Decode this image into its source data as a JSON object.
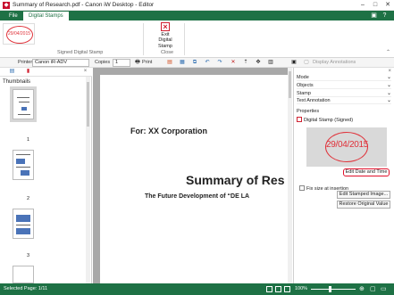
{
  "window": {
    "title": "Summary of Research.pdf - Canon iW Desktop - Editor",
    "app_icon": "canon-app-icon"
  },
  "ribbon": {
    "tabs": [
      {
        "label": "File"
      },
      {
        "label": "Digital Stamps"
      }
    ],
    "signed_stamp_group_label": "Signed Digital Stamp",
    "stamp_thumb_text": "29/04/2015",
    "exit_button_label_line1": "Exit Digital",
    "exit_button_label_line2": "Stamp",
    "close_group_label": "Close",
    "accent_color": "#1e7145"
  },
  "toolbar": {
    "printer_label": "Printer",
    "printer_value": "Canon iR-ADV",
    "copies_label": "Copies",
    "copies_value": "1",
    "print_label": "Print",
    "display_annotations_label": "Display Annotations"
  },
  "thumbnails": {
    "header": "Thumbnails",
    "pages": [
      "1",
      "2",
      "3"
    ]
  },
  "document": {
    "corp_text": "For: XX Corporation",
    "title_text": "Summary of Res",
    "subtitle_text": "The Future Development of “DE LA"
  },
  "right_panel": {
    "sections": [
      "Mode",
      "Objects",
      "Stamp",
      "Text Annotation"
    ],
    "properties_label": "Properties",
    "property_item": "Digital Stamp (Signed)",
    "preview_date": "29/04/2015",
    "edit_date_button": "Edit Date and Time",
    "fix_size_label": "Fix size at insertion",
    "edit_stamped_image_button": "Edit Stamped Image...",
    "restore_button": "Restore Original Value"
  },
  "status": {
    "selected_page": "Selected Page: 1/11",
    "zoom": "100%"
  }
}
